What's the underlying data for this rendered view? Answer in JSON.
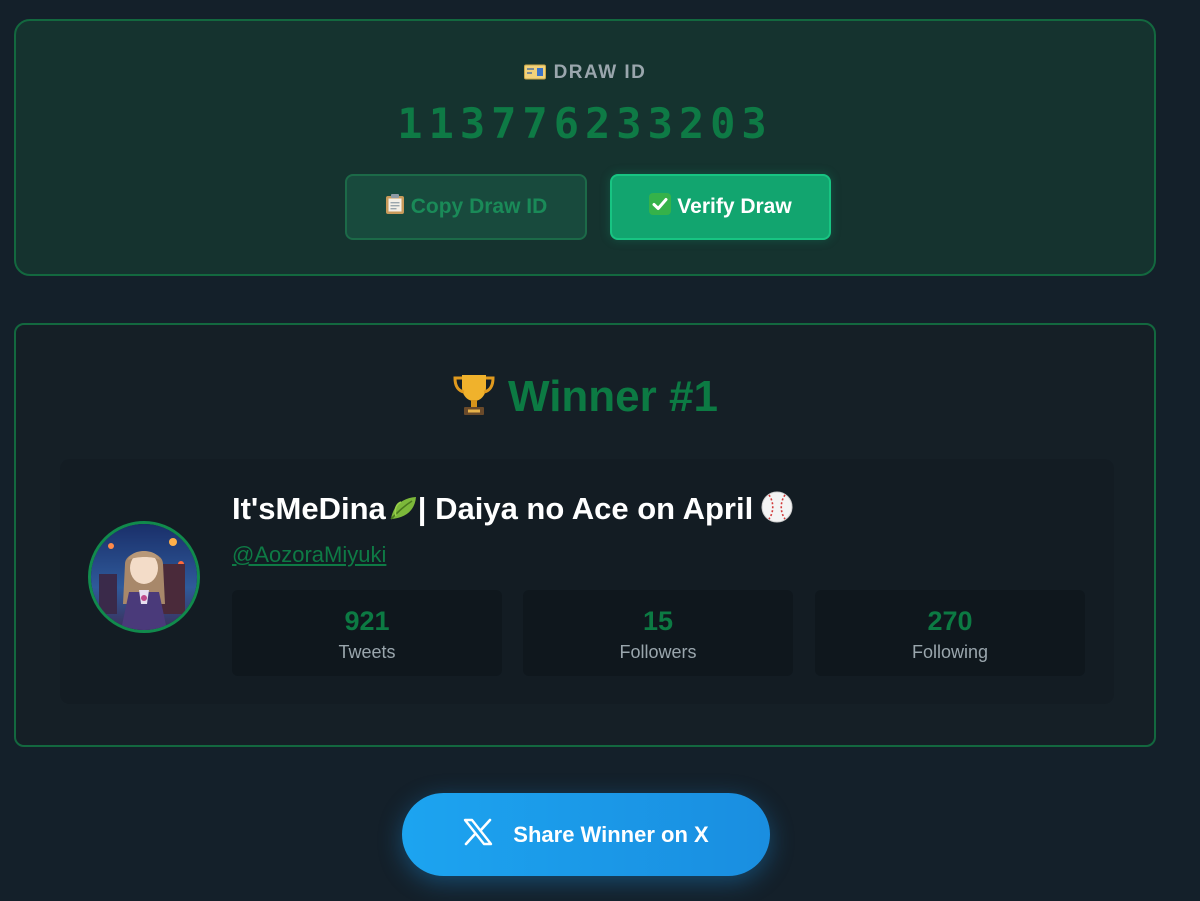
{
  "draw": {
    "label": "DRAW ID",
    "label_icon": "ticket-icon",
    "id": "113776233203",
    "copy_button": {
      "icon": "clipboard-icon",
      "label": "Copy Draw ID"
    },
    "verify_button": {
      "icon": "check-icon",
      "label": "Verify Draw"
    }
  },
  "winner": {
    "title_icon": "trophy-icon",
    "title": "Winner #1",
    "display_name": "It'sMeDina",
    "display_name_rest": "| Daiya no Ace on April",
    "handle": "@AozoraMiyuki",
    "stats": [
      {
        "value": "921",
        "label": "Tweets"
      },
      {
        "value": "15",
        "label": "Followers"
      },
      {
        "value": "270",
        "label": "Following"
      }
    ]
  },
  "share": {
    "icon": "x-logo-icon",
    "label": "Share Winner on X"
  },
  "colors": {
    "accent_green": "#0c7a43",
    "verify_green": "#12a56f",
    "share_blue": "#1d9bf0",
    "background": "#14202a"
  }
}
